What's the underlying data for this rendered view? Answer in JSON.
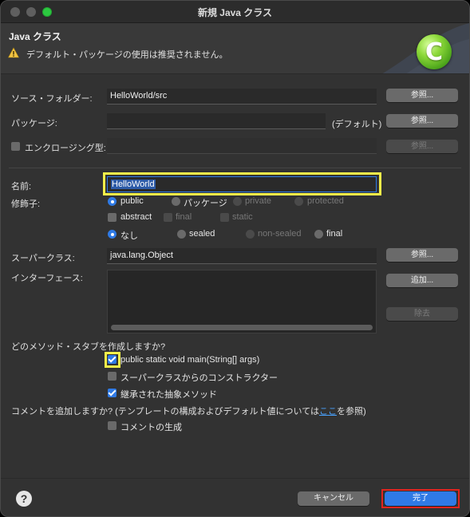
{
  "window": {
    "title": "新規 Java クラス"
  },
  "banner": {
    "title": "Java クラス",
    "message": "デフォルト・パッケージの使用は推奨されません。"
  },
  "source_folder": {
    "label": "ソース・フォルダー:",
    "value": "HelloWorld/src",
    "browse": "参照..."
  },
  "package": {
    "label": "パッケージ:",
    "value": "",
    "default_hint": "(デフォルト)",
    "browse": "参照..."
  },
  "enclosing": {
    "label": "エンクロージング型:",
    "value": "",
    "browse": "参照..."
  },
  "name": {
    "label": "名前:",
    "value": "HelloWorld"
  },
  "modifiers": {
    "label": "修飾子:",
    "access": [
      "public",
      "パッケージ",
      "private",
      "protected"
    ],
    "flags": [
      "abstract",
      "final",
      "static"
    ],
    "inherit": [
      "なし",
      "sealed",
      "non-sealed",
      "final"
    ]
  },
  "superclass": {
    "label": "スーパークラス:",
    "value": "java.lang.Object",
    "browse": "参照..."
  },
  "interfaces": {
    "label": "インターフェース:",
    "add": "追加...",
    "remove": "除去"
  },
  "stubs": {
    "question": "どのメソッド・スタブを作成しますか?",
    "items": [
      "public static void main(String[] args)",
      "スーパークラスからのコンストラクター",
      "継承された抽象メソッド"
    ],
    "checked": [
      true,
      false,
      true
    ]
  },
  "comments": {
    "question_prefix": "コメントを追加しますか? (テンプレートの構成およびデフォルト値については",
    "link": "ここ",
    "question_suffix": "を参照)",
    "generate": "コメントの生成"
  },
  "footer": {
    "help": "?",
    "cancel": "キャンセル",
    "finish": "完了"
  },
  "colors": {
    "accent": "#2f7ae5",
    "highlight": "#f5f24a",
    "finish_outline": "#e2241d"
  }
}
